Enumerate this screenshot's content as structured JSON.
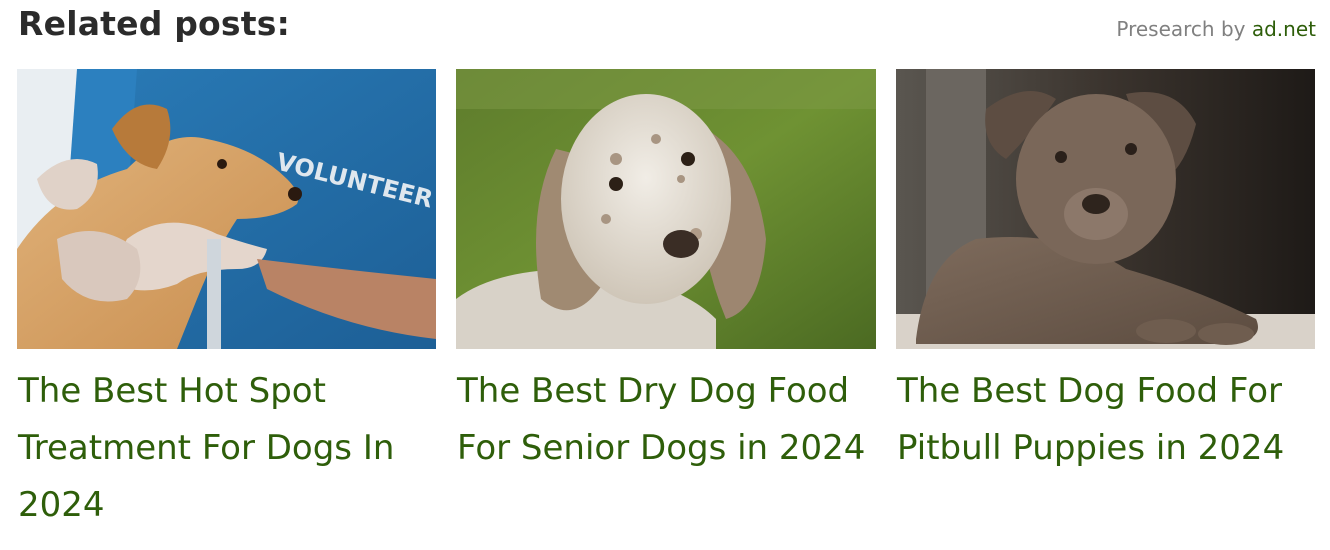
{
  "header": {
    "title": "Related posts:",
    "attribution_prefix": "Presearch by",
    "attribution_brand": "ad.net"
  },
  "posts": [
    {
      "title": "The Best Hot Spot Treatment For Dogs In 2024",
      "image_icon": "dog-volunteer-photo"
    },
    {
      "title": "The Best Dry Dog Food For Senior Dogs in 2024",
      "image_icon": "senior-spaniel-photo"
    },
    {
      "title": "The Best Dog Food For Pitbull Puppies in 2024",
      "image_icon": "pitbull-puppy-photo"
    }
  ],
  "colors": {
    "heading": "#2b2b2b",
    "link": "#2e5e0a",
    "muted": "#808080"
  }
}
